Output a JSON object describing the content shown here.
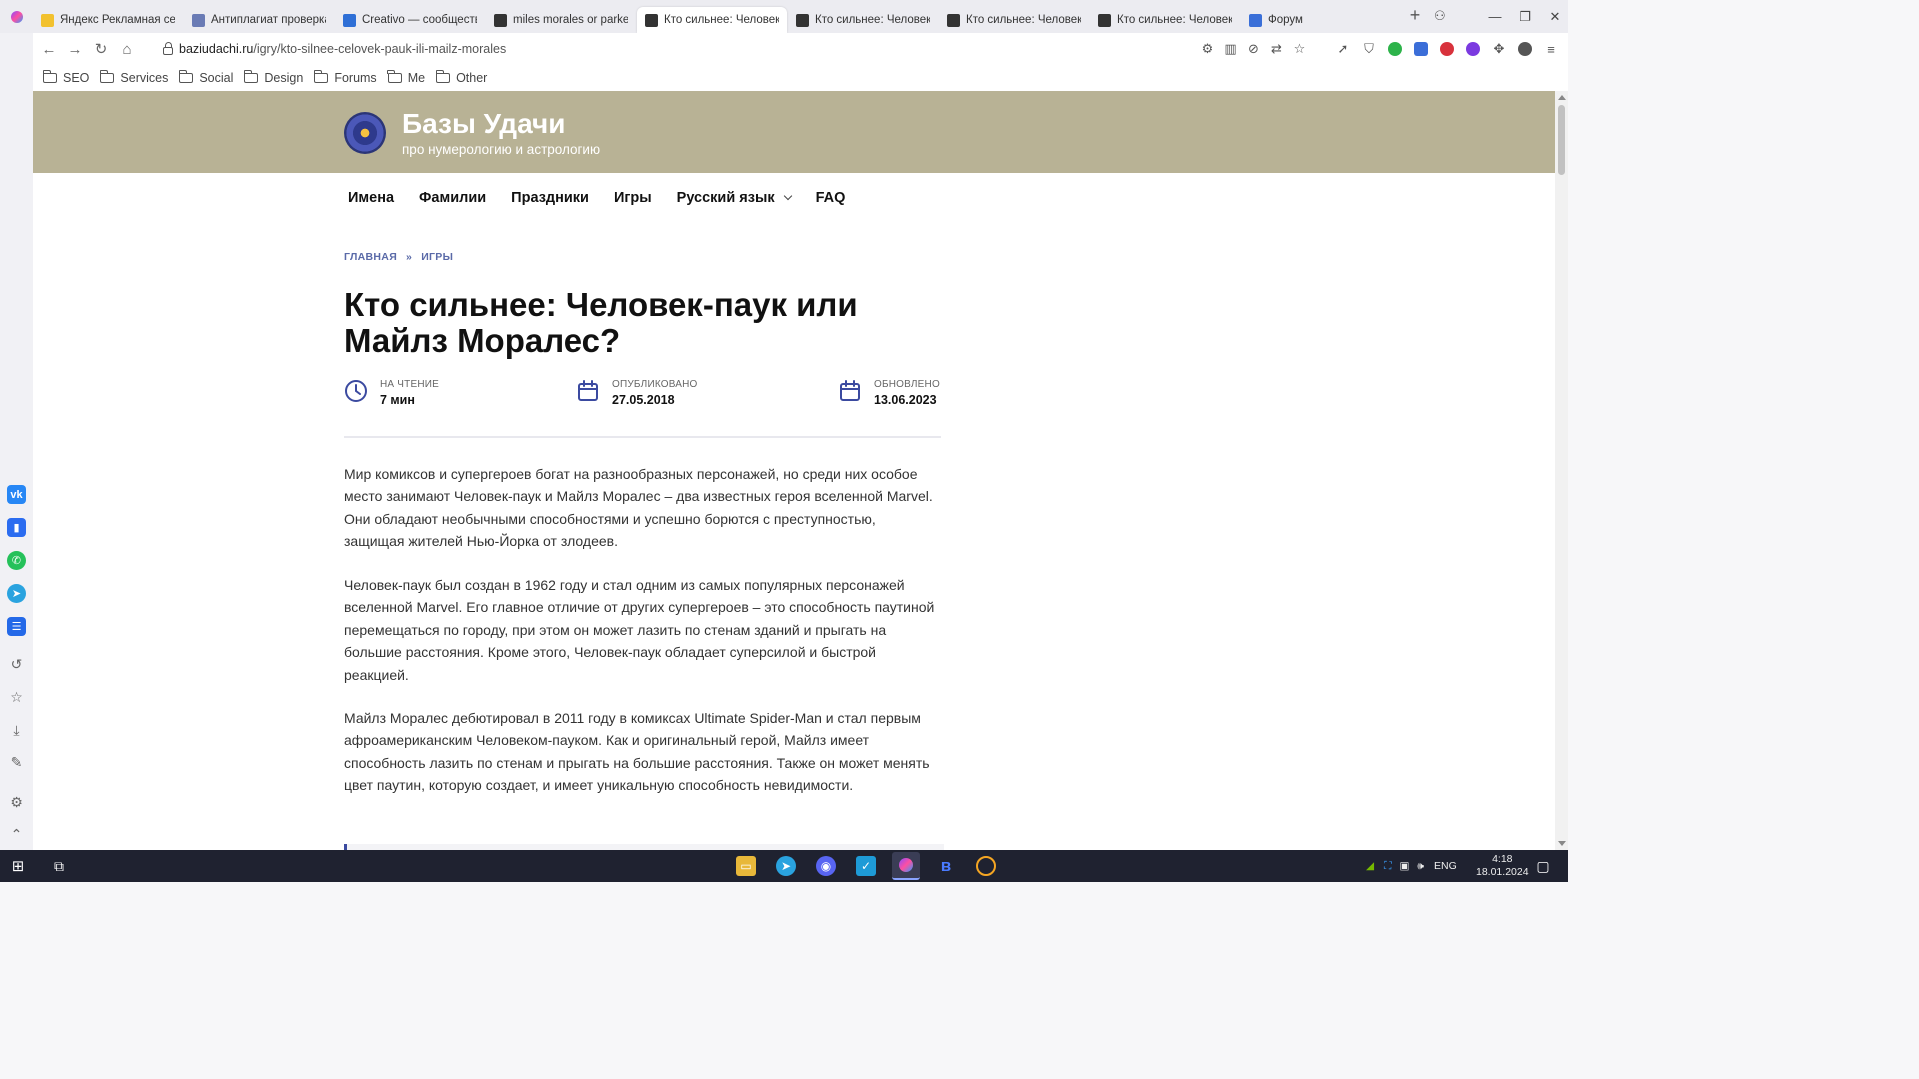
{
  "browser": {
    "tabs": [
      {
        "title": "Яндекс Рекламная сеть",
        "icon": "yandex-icon",
        "color": "#f2c12e"
      },
      {
        "title": "Антиплагиат проверка",
        "icon": "antiplagiat-icon",
        "color": "#6a7bb5"
      },
      {
        "title": "Creativo — сообщество л",
        "icon": "creativo-icon",
        "color": "#2f6fd6"
      },
      {
        "title": "miles morales or parker —",
        "icon": "incognito-icon",
        "color": "#333333"
      },
      {
        "title": "Кто сильнее: Человек-па",
        "icon": "incognito-icon",
        "color": "#333333",
        "active": true
      },
      {
        "title": "Кто сильнее: Человек-па",
        "icon": "incognito-icon",
        "color": "#333333"
      },
      {
        "title": "Кто сильнее: Человек-па",
        "icon": "incognito-icon",
        "color": "#333333"
      },
      {
        "title": "Кто сильнее: Человек-Па",
        "icon": "incognito-icon",
        "color": "#333333"
      },
      {
        "title": "Форум",
        "icon": "forum-icon",
        "color": "#3a6fd8"
      }
    ],
    "url_domain": "baziudachi.ru",
    "url_path": "/igry/kto-silnee-celovek-pauk-ili-mailz-morales",
    "bookmarks": [
      "SEO",
      "Services",
      "Social",
      "Design",
      "Forums",
      "Me",
      "Other"
    ]
  },
  "site": {
    "title": "Базы Удачи",
    "subtitle": "про нумерологию и астрологию",
    "header_color": "#b8b295",
    "nav": [
      "Имена",
      "Фамилии",
      "Праздники",
      "Игры",
      "Русский язык",
      "FAQ"
    ]
  },
  "breadcrumb": {
    "home": "ГЛАВНАЯ",
    "separator": "»",
    "current": "ИГРЫ"
  },
  "article": {
    "title": "Кто сильнее: Человек-паук или Майлз Моралес?",
    "meta": {
      "reading_label": "НА ЧТЕНИЕ",
      "reading_value": "7 мин",
      "published_label": "ОПУБЛИКОВАНО",
      "published_value": "27.05.2018",
      "updated_label": "ОБНОВЛЕНО",
      "updated_value": "13.06.2023"
    },
    "paragraphs": [
      "Мир комиксов и супергероев богат на разнообразных персонажей, но среди них особое место занимают Человек-паук и Майлз Моралес – два известных героя вселенной Marvel. Они обладают необычными способностями и успешно борются с преступностью, защищая жителей Нью-Йорка от злодеев.",
      "Человек-паук был создан в 1962 году и стал одним из самых популярных персонажей вселенной Marvel. Его главное отличие от других супергероев – это способность паутиной перемещаться по городу, при этом он может лазить по стенам зданий и прыгать на большие расстояния. Кроме этого, Человек-паук обладает суперсилой и быстрой реакцией.",
      "Майлз Моралес дебютировал в 2011 году в комиксах Ultimate Spider-Man и стал первым афроамериканским Человеком-пауком. Как и оригинальный герой, Майлз имеет способность лазить по стенам и прыгать на большие расстояния. Также он может менять цвет паутин, которую создает, и имеет уникальную способность невидимости."
    ]
  },
  "taskbar": {
    "language": "ENG",
    "time": "4:18",
    "date": "18.01.2024"
  }
}
